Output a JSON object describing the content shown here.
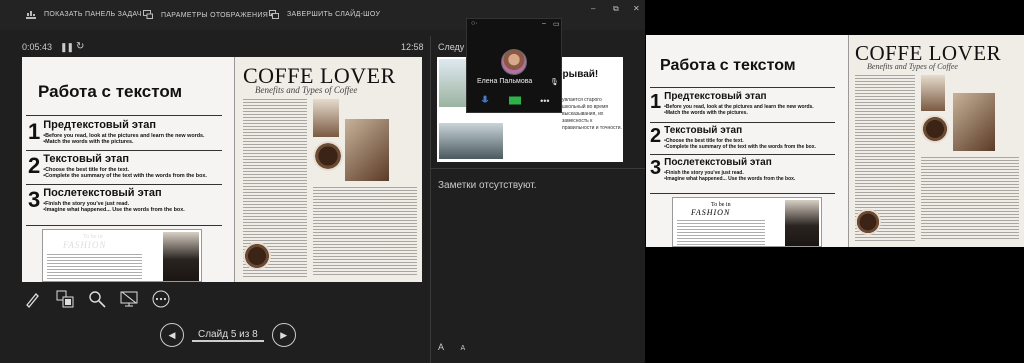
{
  "toolbar": {
    "show_taskbar": "ПОКАЗАТЬ ПАНЕЛЬ ЗАДАЧ",
    "display_settings": "ПАРАМЕТРЫ ОТОБРАЖЕНИЯ ▾",
    "end_show": "ЗАВЕРШИТЬ СЛАЙД-ШОУ"
  },
  "timer": "0:05:43",
  "clock": "12:58",
  "next_label": "Следу",
  "notes": "Заметки отсутствуют.",
  "nav": {
    "counter": "Слайд 5 из 8"
  },
  "call": {
    "name": "Елена Пальмова"
  },
  "slide": {
    "title": "Работа с текстом",
    "stages": [
      {
        "num": "1",
        "head": "Предтекстовый этап",
        "lines": [
          "•Before you read, look at the pictures and learn the new words.",
          "•Match the words with the pictures."
        ]
      },
      {
        "num": "2",
        "head": "Текстовый этап",
        "lines": [
          "•Choose the best title for the text.",
          "•Complete the summary of the text with the words from the box."
        ]
      },
      {
        "num": "3",
        "head": "Послетекстовый этап",
        "lines": [
          "•Finish the story you've just read.",
          "•Imagine what happened... Use the words from the box."
        ]
      }
    ],
    "coffee_title": "COFFE LOVER",
    "coffee_sub": "Benefits and Types of Coffee",
    "fashion_top": "To be in",
    "fashion_word": "FASHION"
  },
  "next_slide": {
    "headline": "ерывай!",
    "text": "увлается старого школьный во время высказывания, их замесность к правильности и точности."
  },
  "font_buttons": {
    "increase": "A",
    "decrease": "A"
  }
}
